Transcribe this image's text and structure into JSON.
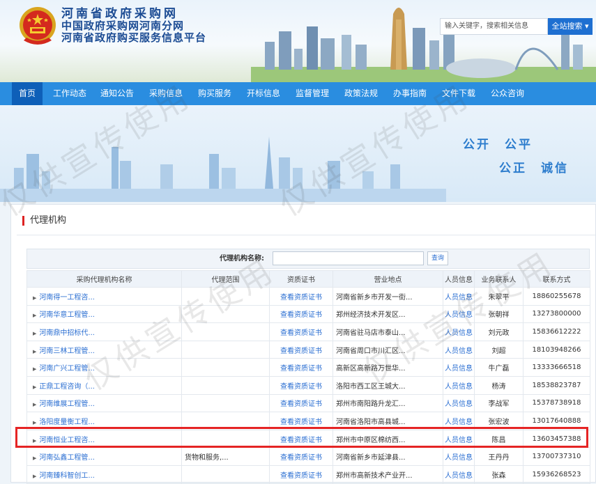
{
  "header": {
    "title_line1": "河南省政府采购网",
    "title_line2": "中国政府采购网河南分网",
    "title_line3": "河南省政府购买服务信息平台",
    "search_placeholder": "输入关键字，搜索相关信息",
    "search_button": "全站搜索 ▾"
  },
  "nav": {
    "items": [
      "首页",
      "工作动态",
      "通知公告",
      "采购信息",
      "购买服务",
      "开标信息",
      "监督管理",
      "政策法规",
      "办事指南",
      "文件下载",
      "公众咨询"
    ]
  },
  "banner": {
    "slogan1": "公开　公平",
    "slogan2": "公正　诚信"
  },
  "panel": {
    "title": "代理机构",
    "filter_label": "代理机构名称:",
    "query_button": "查询"
  },
  "table": {
    "headers": [
      "采购代理机构名称",
      "代理范围",
      "资质证书",
      "营业地点",
      "人员信息",
      "业务联系人",
      "联系方式"
    ],
    "rows": [
      {
        "name": "河南得一工程咨...",
        "scope": "",
        "cert": "查看资质证书",
        "loc": "河南省新乡市开发一街...",
        "staff": "人员信息",
        "contact": "朱翠平",
        "phone": "18860255678"
      },
      {
        "name": "河南华意工程管...",
        "scope": "",
        "cert": "查看资质证书",
        "loc": "郑州经济技术开发区...",
        "staff": "人员信息",
        "contact": "张朝祥",
        "phone": "13273800000"
      },
      {
        "name": "河南鼎中招标代...",
        "scope": "",
        "cert": "查看资质证书",
        "loc": "河南省驻马店市泰山...",
        "staff": "人员信息",
        "contact": "刘元政",
        "phone": "15836612222"
      },
      {
        "name": "河南三林工程管...",
        "scope": "",
        "cert": "查看资质证书",
        "loc": "河南省周口市川汇区...",
        "staff": "人员信息",
        "contact": "刘超",
        "phone": "18103948266"
      },
      {
        "name": "河南广兴工程管...",
        "scope": "",
        "cert": "查看资质证书",
        "loc": "高新区高新路万世华...",
        "staff": "人员信息",
        "contact": "牛广磊",
        "phone": "13333666518"
      },
      {
        "name": "正鼎工程咨询（...",
        "scope": "",
        "cert": "查看资质证书",
        "loc": "洛阳市西工区王城大...",
        "staff": "人员信息",
        "contact": "杨涛",
        "phone": "18538823787"
      },
      {
        "name": "河南维展工程管...",
        "scope": "",
        "cert": "查看资质证书",
        "loc": "郑州市南阳路升龙汇...",
        "staff": "人员信息",
        "contact": "李战军",
        "phone": "15378738918"
      },
      {
        "name": "洛阳度量衡工程...",
        "scope": "",
        "cert": "查看资质证书",
        "loc": "河南省洛阳市高县城...",
        "staff": "人员信息",
        "contact": "张宏波",
        "phone": "13017640888"
      },
      {
        "name": "河南恒业工程咨...",
        "scope": "",
        "cert": "查看资质证书",
        "loc": "郑州市中原区棉纺西...",
        "staff": "人员信息",
        "contact": "陈昌",
        "phone": "13603457388"
      },
      {
        "name": "河南弘鑫工程管...",
        "scope": "货物和服务,...",
        "cert": "查看资质证书",
        "loc": "河南省新乡市延津县...",
        "staff": "人员信息",
        "contact": "王丹丹",
        "phone": "13700737310"
      },
      {
        "name": "河南臻科智创工...",
        "scope": "",
        "cert": "查看资质证书",
        "loc": "郑州市高新技术产业开...",
        "staff": "人员信息",
        "contact": "张森",
        "phone": "15936268523"
      }
    ]
  },
  "watermark": "仅供宣传使用",
  "colors": {
    "nav_blue": "#2a8de0",
    "nav_active": "#0e5fb8",
    "link_blue": "#2a6ed2",
    "title_blue": "#1b4b93",
    "highlight_red": "#e52424"
  }
}
